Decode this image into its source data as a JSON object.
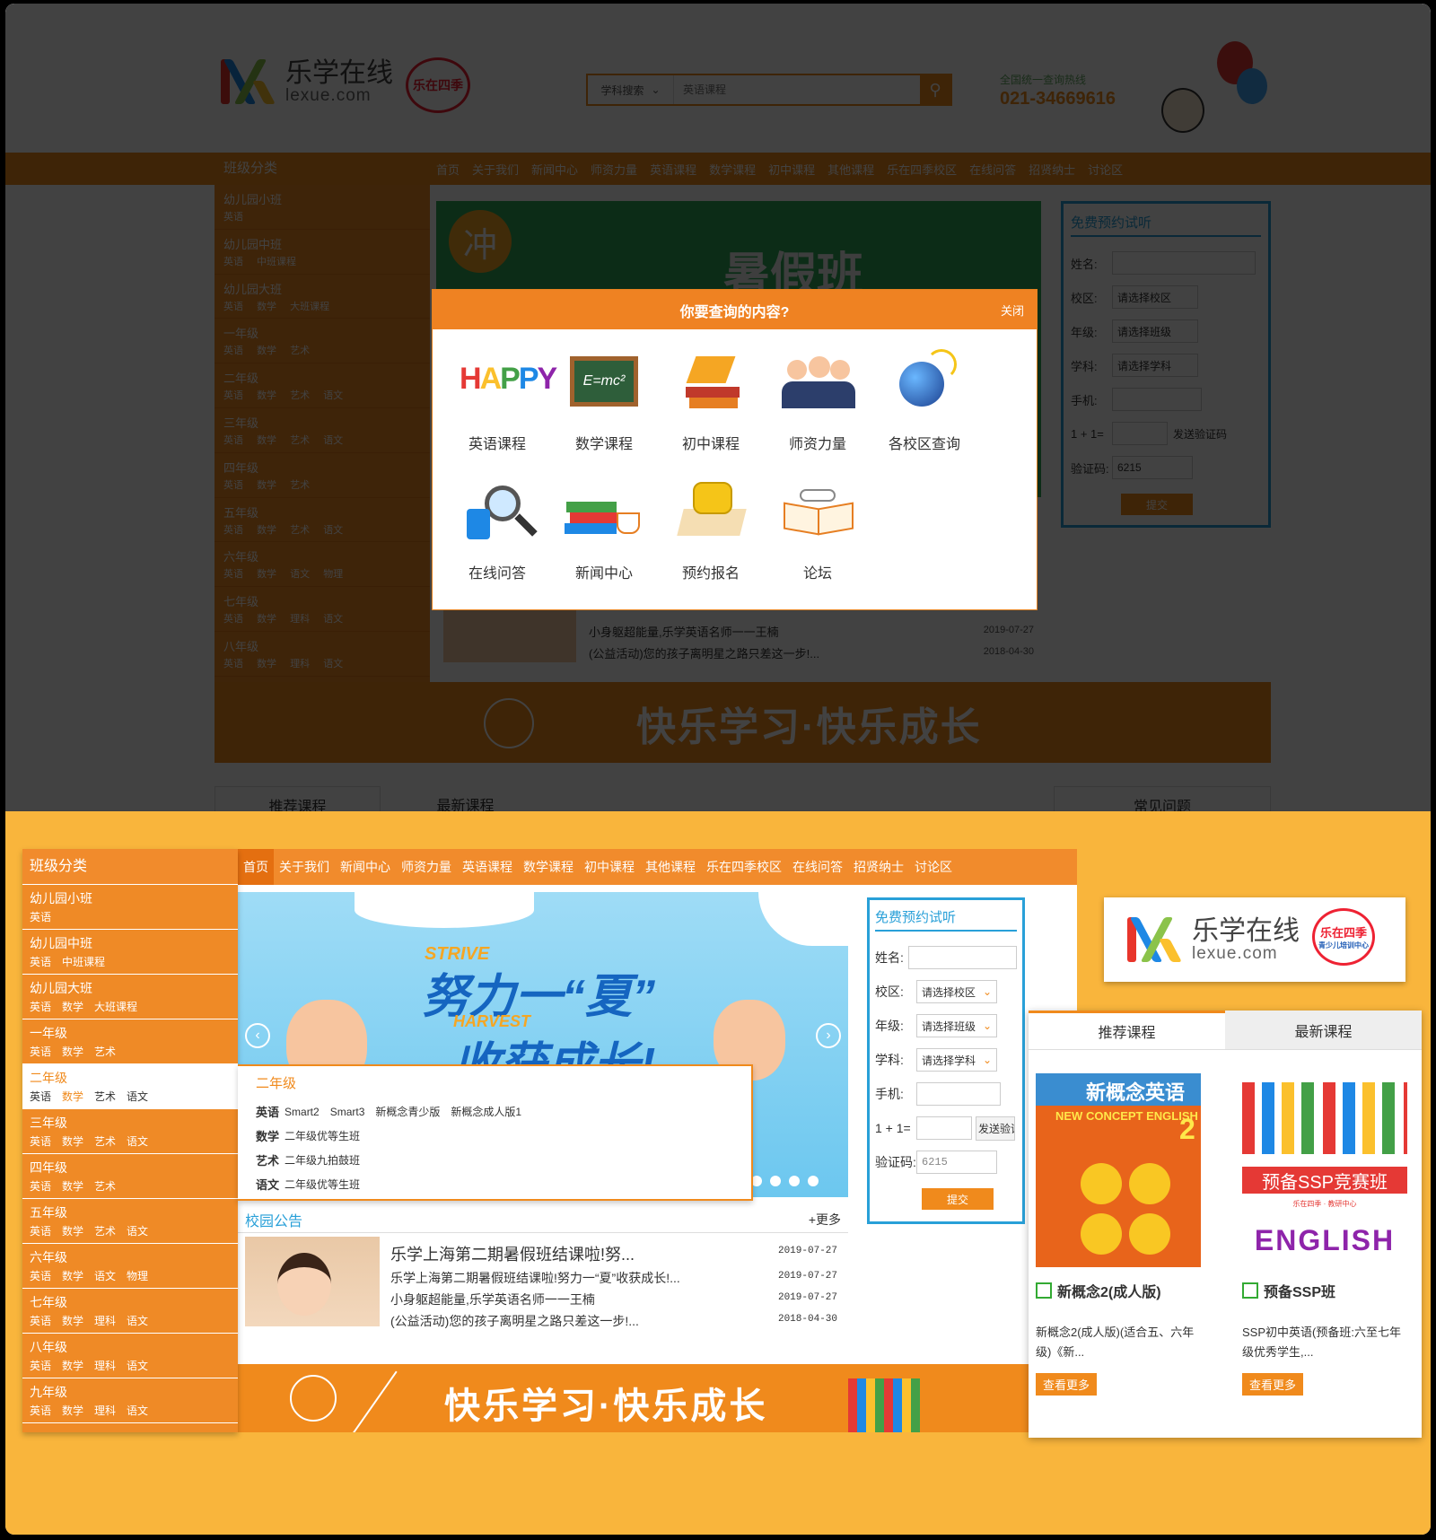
{
  "brand": {
    "name_cn": "乐学在线",
    "name_en": "lexue.com",
    "badge": "乐在四季",
    "badge_sub": "青少儿培训中心"
  },
  "search": {
    "category": "学科搜索",
    "placeholder": "英语课程"
  },
  "hotline": {
    "label": "全国统一查询热线",
    "number": "021-34669616"
  },
  "nav": [
    "首页",
    "关于我们",
    "新闻中心",
    "师资力量",
    "英语课程",
    "数学课程",
    "初中课程",
    "其他课程",
    "乐在四季校区",
    "在线问答",
    "招贤纳士",
    "讨论区"
  ],
  "categories": {
    "title": "班级分类",
    "items": [
      {
        "name": "幼儿园小班",
        "subjects": [
          "英语"
        ]
      },
      {
        "name": "幼儿园中班",
        "subjects": [
          "英语",
          "中班课程"
        ]
      },
      {
        "name": "幼儿园大班",
        "subjects": [
          "英语",
          "数学",
          "大班课程"
        ]
      },
      {
        "name": "一年级",
        "subjects": [
          "英语",
          "数学",
          "艺术"
        ]
      },
      {
        "name": "二年级",
        "subjects": [
          "英语",
          "数学",
          "艺术",
          "语文"
        ]
      },
      {
        "name": "三年级",
        "subjects": [
          "英语",
          "数学",
          "艺术",
          "语文"
        ]
      },
      {
        "name": "四年级",
        "subjects": [
          "英语",
          "数学",
          "艺术"
        ]
      },
      {
        "name": "五年级",
        "subjects": [
          "英语",
          "数学",
          "艺术",
          "语文"
        ]
      },
      {
        "name": "六年级",
        "subjects": [
          "英语",
          "数学",
          "语文",
          "物理"
        ]
      },
      {
        "name": "七年级",
        "subjects": [
          "英语",
          "数学",
          "理科",
          "语文"
        ]
      },
      {
        "name": "八年级",
        "subjects": [
          "英语",
          "数学",
          "理科",
          "语文"
        ]
      },
      {
        "name": "九年级",
        "subjects": [
          "英语",
          "数学",
          "理科",
          "语文"
        ]
      }
    ]
  },
  "modal": {
    "title": "你要查询的内容?",
    "close": "关闭",
    "items": [
      {
        "label": "英语课程",
        "icon": "happy-letters-icon"
      },
      {
        "label": "数学课程",
        "icon": "chalkboard-icon"
      },
      {
        "label": "初中课程",
        "icon": "graduation-books-icon"
      },
      {
        "label": "师资力量",
        "icon": "teachers-group-icon"
      },
      {
        "label": "各校区查询",
        "icon": "globe-icon"
      },
      {
        "label": "在线问答",
        "icon": "magnifier-icon"
      },
      {
        "label": "新闻中心",
        "icon": "books-cup-icon"
      },
      {
        "label": "预约报名",
        "icon": "telephone-icon"
      },
      {
        "label": "论坛",
        "icon": "open-book-icon"
      }
    ]
  },
  "banner": {
    "top_text": "暑假班",
    "top_tag": "冲"
  },
  "slide": {
    "line1": "努力一“夏”",
    "line2": "收获成长!",
    "tag1": "STRIVE",
    "tag2": "HARVEST"
  },
  "popup": {
    "grade": "二年级",
    "rows": [
      {
        "subject": "英语",
        "courses": [
          "Smart2",
          "Smart3",
          "新概念青少版",
          "新概念成人版1"
        ]
      },
      {
        "subject": "数学",
        "courses": [
          "二年级优等生班"
        ]
      },
      {
        "subject": "艺术",
        "courses": [
          "二年级九拍鼓班"
        ]
      },
      {
        "subject": "语文",
        "courses": [
          "二年级优等生班"
        ]
      }
    ]
  },
  "trial_form": {
    "title": "免费预约试听",
    "name_label": "姓名:",
    "campus_label": "校区:",
    "campus_value": "请选择校区",
    "grade_label": "年级:",
    "grade_value": "请选择班级",
    "subject_label": "学科:",
    "subject_value": "请选择学科",
    "phone_label": "手机:",
    "captcha_q": "1 + 1=",
    "send_code": "发送验证码",
    "code_label": "验证码:",
    "code_value": "6215",
    "submit": "提交"
  },
  "announcements": {
    "title": "校园公告",
    "more": "+更多",
    "items": [
      {
        "text": "乐学上海第二期暑假班结课啦!努...",
        "date": "2019-07-27"
      },
      {
        "text": "乐学上海第二期暑假班结课啦!努力一“夏”收获成长!...",
        "date": "2019-07-27"
      },
      {
        "text": "小身躯超能量,乐学英语名师一一王楠",
        "date": "2019-07-27"
      },
      {
        "text": "(公益活动)您的孩子离明星之路只差这一步!...",
        "date": "2018-04-30"
      }
    ]
  },
  "slogan": "快乐学习·快乐成长",
  "course_tabs": [
    "推荐课程",
    "最新课程"
  ],
  "faq_tab": "常见问题",
  "courses": [
    {
      "name": "新概念2(成人版)",
      "desc": "新概念2(成人版)(适合五、六年级)《新...",
      "more": "查看更多",
      "cover_title": "新概念英语",
      "cover_en": "NEW CONCEPT ENGLISH",
      "cover_num": "2"
    },
    {
      "name": "预备SSP班",
      "desc": "SSP初中英语(预备班:六至七年级优秀学生,...",
      "more": "查看更多",
      "cover_title": "预备SSP竞赛班",
      "cover_en": "ENGLISH",
      "cover_sub": "乐在四季 · 教研中心"
    }
  ]
}
